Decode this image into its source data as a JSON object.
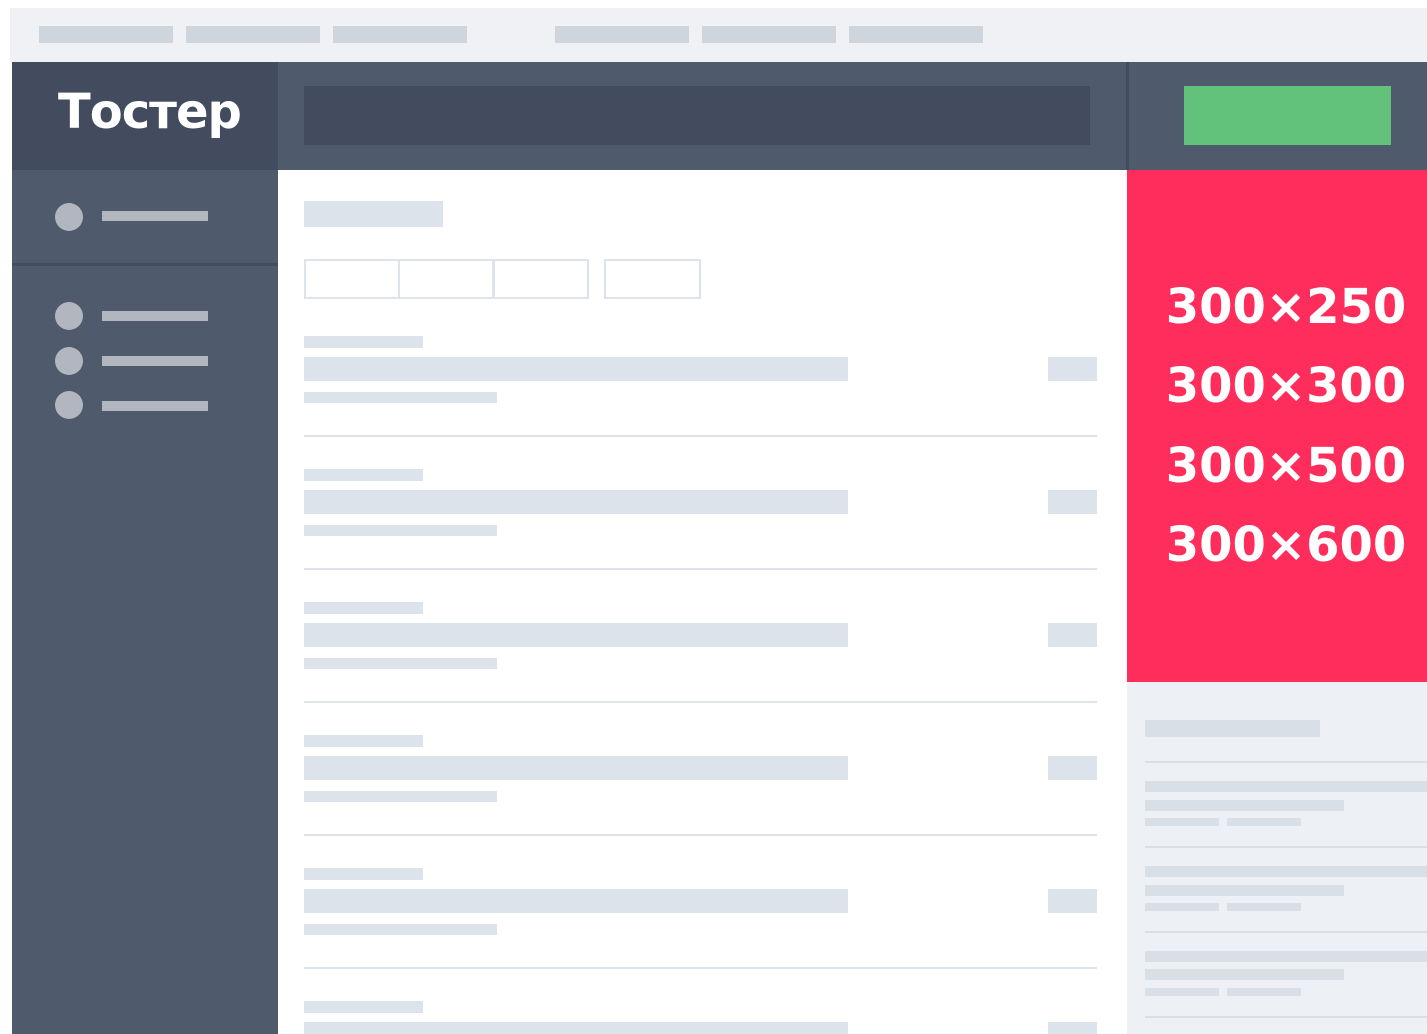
{
  "header": {
    "logo_text": "Тостер"
  },
  "ad_block": {
    "background": "#ff2d5b",
    "sizes": [
      "300×250",
      "300×300",
      "300×500",
      "300×600"
    ]
  },
  "colors": {
    "header": "#4f5a6c",
    "sidebar": "#4f5a6c",
    "cta_button": "#62c27b",
    "placeholder": "#dde3ea"
  }
}
